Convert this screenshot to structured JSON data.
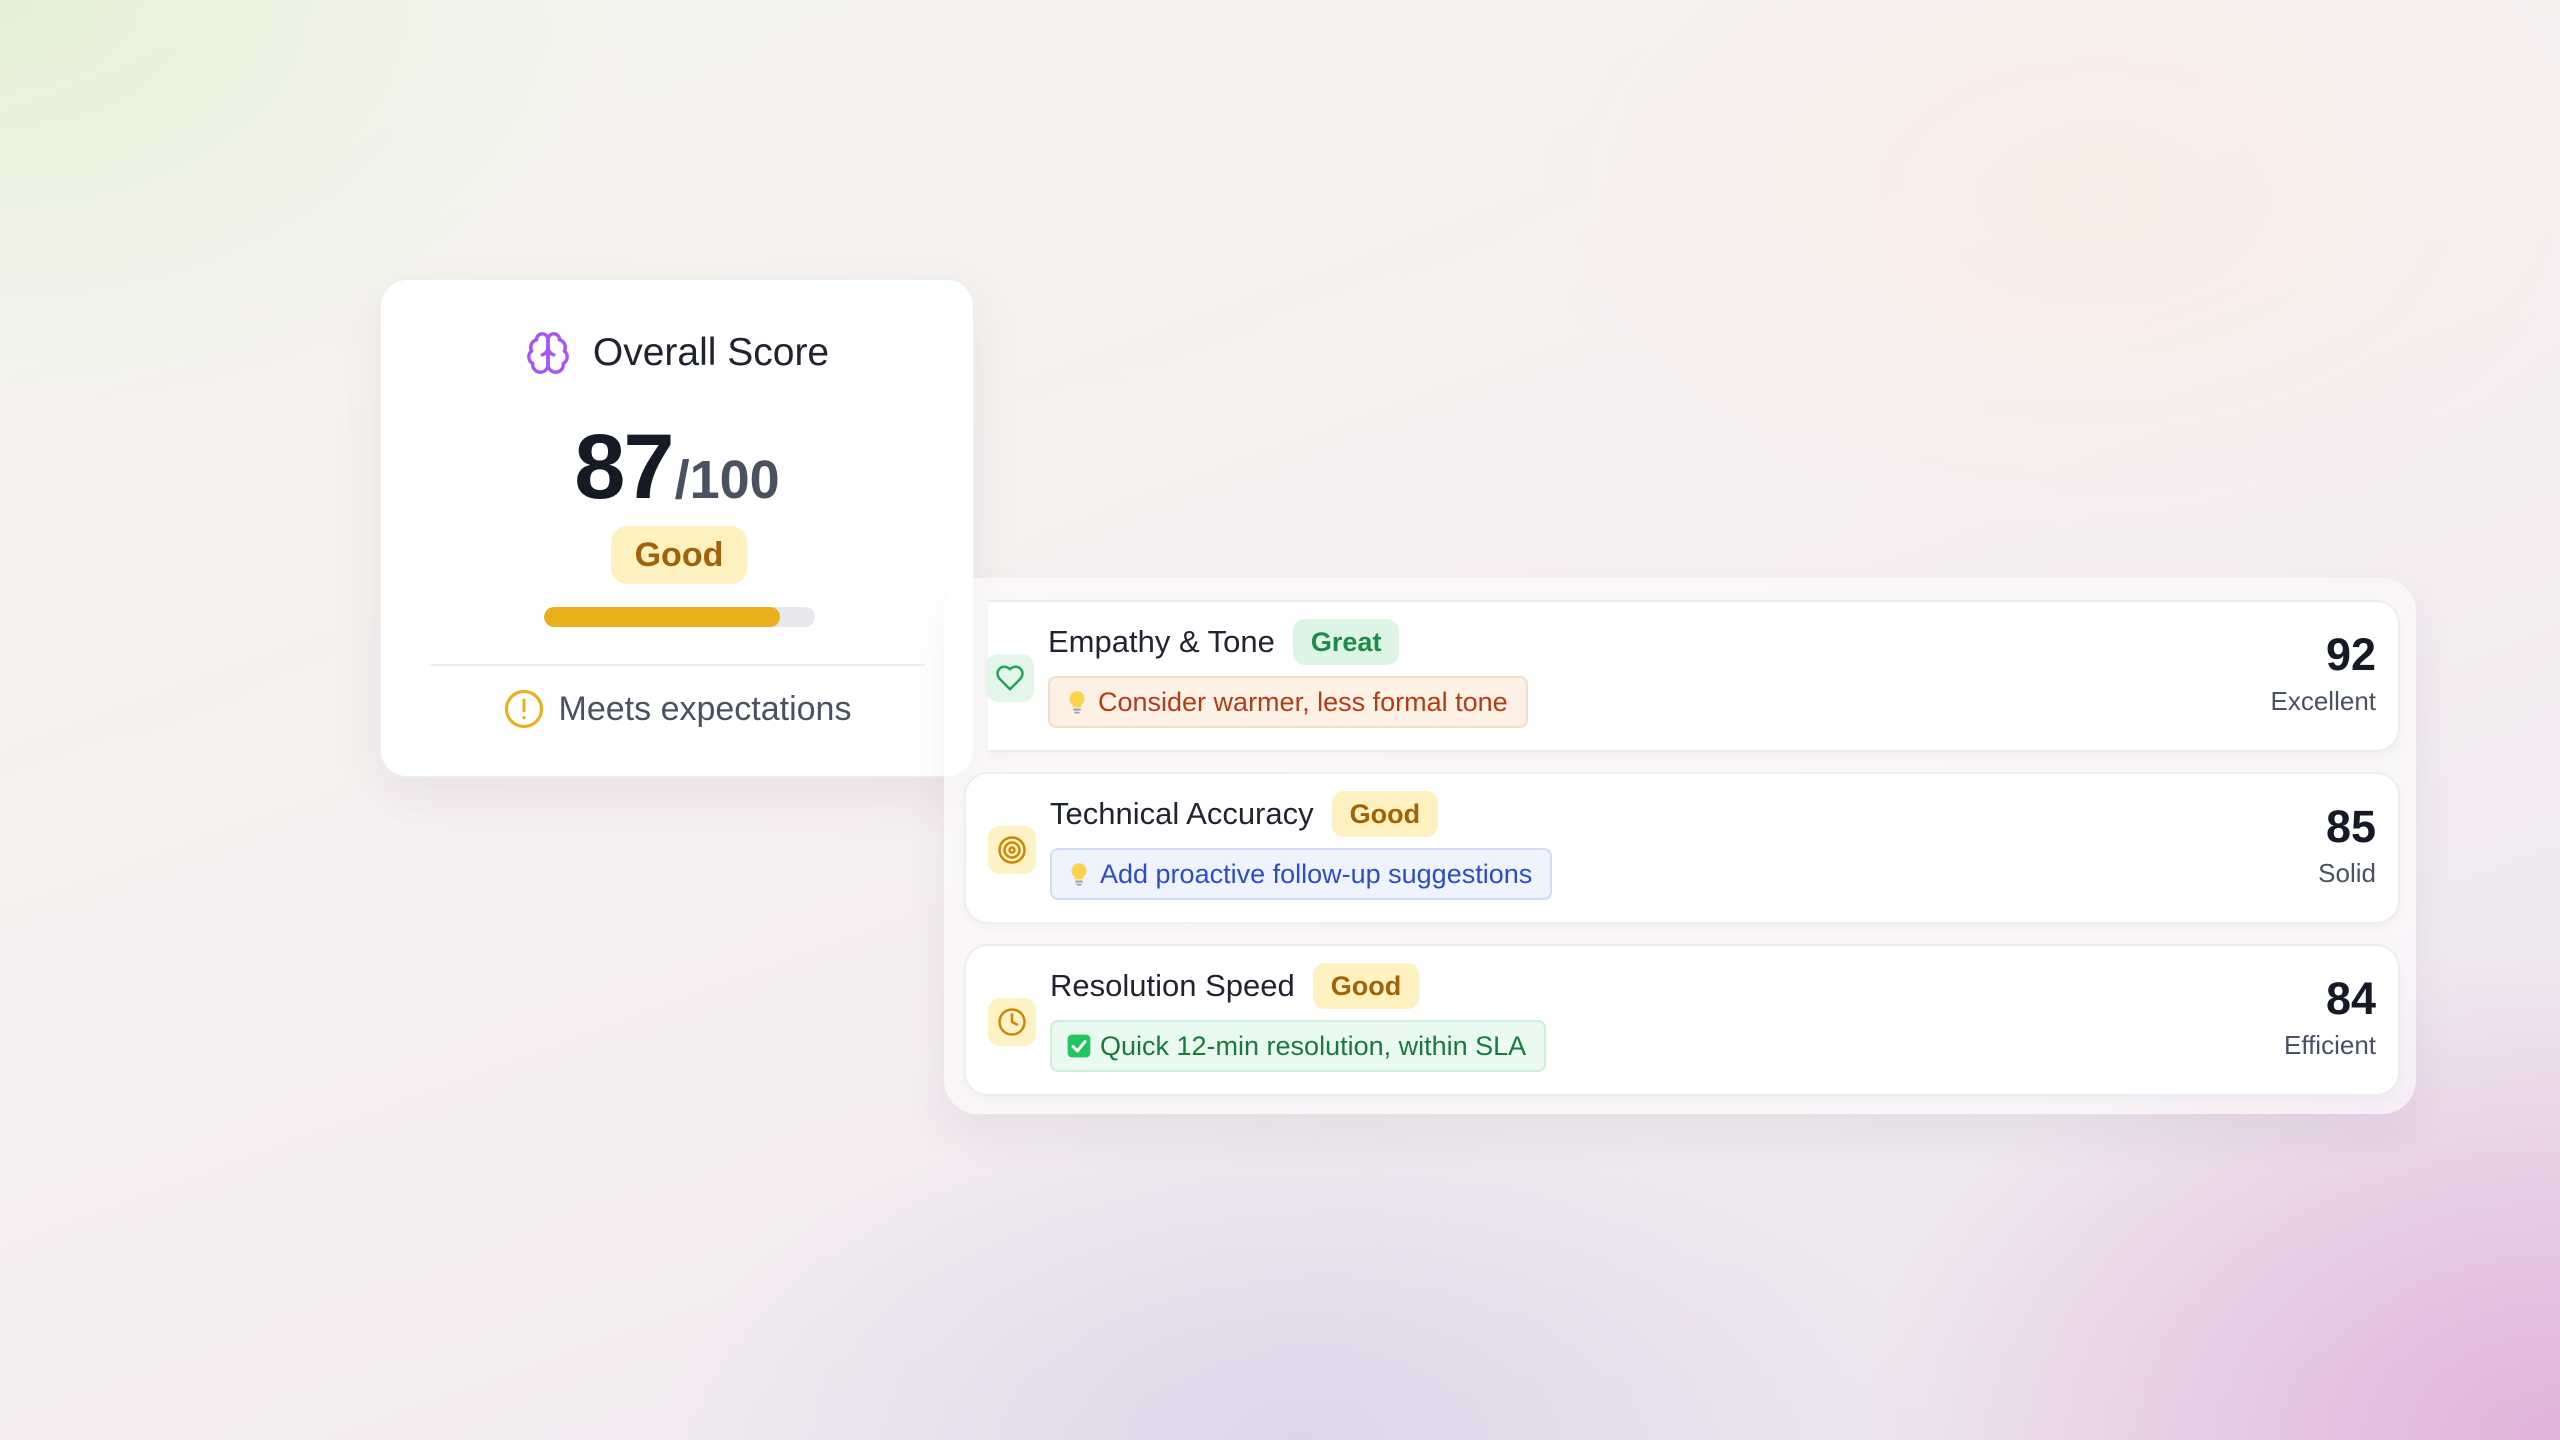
{
  "overall": {
    "title": "Overall Score",
    "title_icon": "brain-icon",
    "score": "87",
    "max": "/100",
    "rating": "Good",
    "progress_percent": 87,
    "status_icon": "alert-circle-icon",
    "status_text": "Meets expectations"
  },
  "metrics": [
    {
      "name": "Empathy & Tone",
      "icon": "heart-icon",
      "badge": "Great",
      "tip_icon": "lightbulb-icon",
      "tip": "Consider warmer, less formal tone",
      "score": "92",
      "score_label": "Excellent"
    },
    {
      "name": "Technical Accuracy",
      "icon": "target-icon",
      "badge": "Good",
      "tip_icon": "lightbulb-icon",
      "tip": "Add proactive follow-up suggestions",
      "score": "85",
      "score_label": "Solid"
    },
    {
      "name": "Resolution Speed",
      "icon": "clock-icon",
      "badge": "Good",
      "tip_icon": "check-box-icon",
      "tip": "Quick 12-min resolution, within SLA",
      "score": "84",
      "score_label": "Efficient"
    }
  ],
  "colors": {
    "accent_purple": "#a855f7",
    "good_amber": "#eab01c",
    "great_green": "#1f8a49",
    "warn_orange": "#b53c12",
    "info_blue": "#2a4fc4"
  }
}
